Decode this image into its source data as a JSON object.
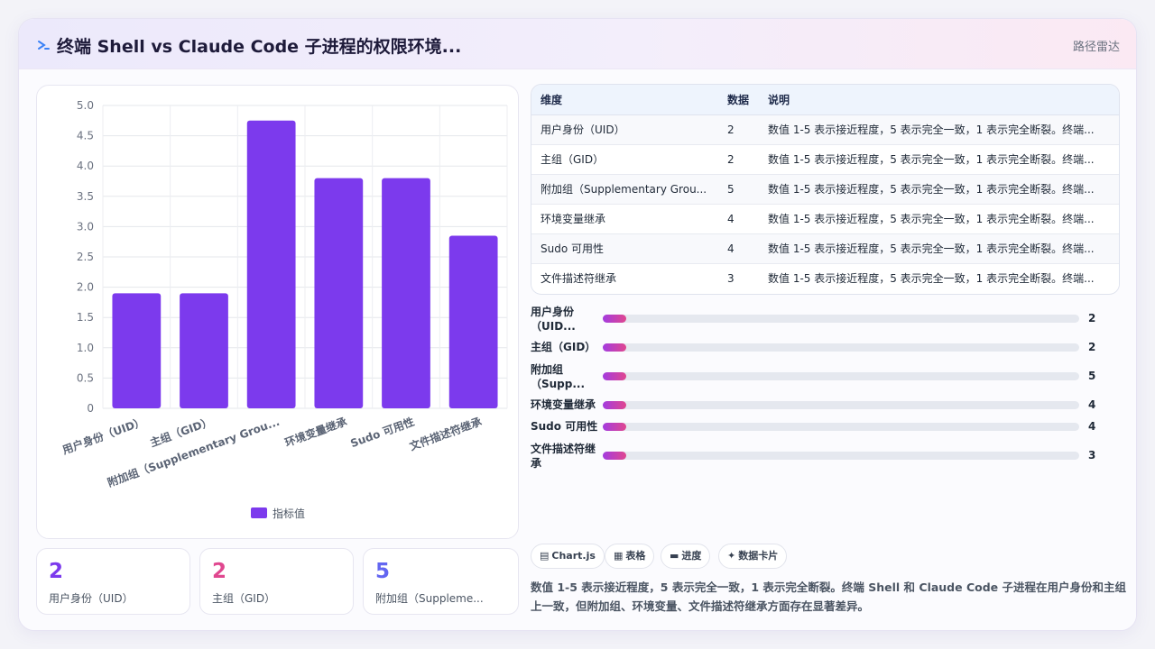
{
  "header": {
    "title": "终端 Shell vs Claude Code 子进程的权限环境...",
    "right_label": "路径雷达"
  },
  "chart_data": {
    "type": "bar",
    "categories": [
      "用户身份（UID）",
      "主组（GID）",
      "附加组（Supplementary Grou...",
      "环境变量继承",
      "Sudo 可用性",
      "文件描述符继承"
    ],
    "series": [
      {
        "name": "指标值",
        "values": [
          1.9,
          1.9,
          4.75,
          3.8,
          3.8,
          2.85
        ]
      }
    ],
    "ylim": [
      0,
      5
    ],
    "yticks": [
      "0",
      "0.5",
      "1.0",
      "1.5",
      "2.0",
      "2.5",
      "3.0",
      "3.5",
      "4.0",
      "4.5",
      "5.0"
    ],
    "bar_color": "#7c3aed",
    "grid": true,
    "legend_position": "bottom"
  },
  "stats": [
    {
      "value": "2",
      "label": "用户身份（UID）",
      "color": "#7c3aed"
    },
    {
      "value": "2",
      "label": "主组（GID）",
      "color": "#e0478f"
    },
    {
      "value": "5",
      "label": "附加组（Suppleme...",
      "color": "#6366f1"
    }
  ],
  "table": {
    "headers": [
      "维度",
      "数据",
      "说明"
    ],
    "rows": [
      [
        "用户身份（UID）",
        "2",
        "数值 1-5 表示接近程度，5 表示完全一致，1 表示完全断裂。终端..."
      ],
      [
        "主组（GID）",
        "2",
        "数值 1-5 表示接近程度，5 表示完全一致，1 表示完全断裂。终端..."
      ],
      [
        "附加组（Supplementary Grou...",
        "5",
        "数值 1-5 表示接近程度，5 表示完全一致，1 表示完全断裂。终端..."
      ],
      [
        "环境变量继承",
        "4",
        "数值 1-5 表示接近程度，5 表示完全一致，1 表示完全断裂。终端..."
      ],
      [
        "Sudo 可用性",
        "4",
        "数值 1-5 表示接近程度，5 表示完全一致，1 表示完全断裂。终端..."
      ],
      [
        "文件描述符继承",
        "3",
        "数值 1-5 表示接近程度，5 表示完全一致，1 表示完全断裂。终端..."
      ]
    ]
  },
  "progress": [
    {
      "label": "用户身份（UID...",
      "value": "2",
      "fill": 0.05
    },
    {
      "label": "主组（GID）",
      "value": "2",
      "fill": 0.05
    },
    {
      "label": "附加组（Supp...",
      "value": "5",
      "fill": 0.05
    },
    {
      "label": "环境变量继承",
      "value": "4",
      "fill": 0.05
    },
    {
      "label": "Sudo 可用性",
      "value": "4",
      "fill": 0.05
    },
    {
      "label": "文件描述符继承",
      "value": "3",
      "fill": 0.05
    }
  ],
  "chips": [
    {
      "icon": "chart-icon",
      "glyph": "▤",
      "label": "Chart.js"
    },
    {
      "icon": "table-icon",
      "glyph": "▦",
      "label": "表格"
    },
    {
      "icon": "progress-icon",
      "glyph": "▬",
      "label": "进度"
    },
    {
      "icon": "card-icon",
      "glyph": "✦",
      "label": "数据卡片"
    }
  ],
  "summary": "数值 1-5 表示接近程度，5 表示完全一致，1 表示完全断裂。终端 Shell 和 Claude Code 子进程在用户身份和主组上一致，但附加组、环境变量、文件描述符继承方面存在显著差异。"
}
